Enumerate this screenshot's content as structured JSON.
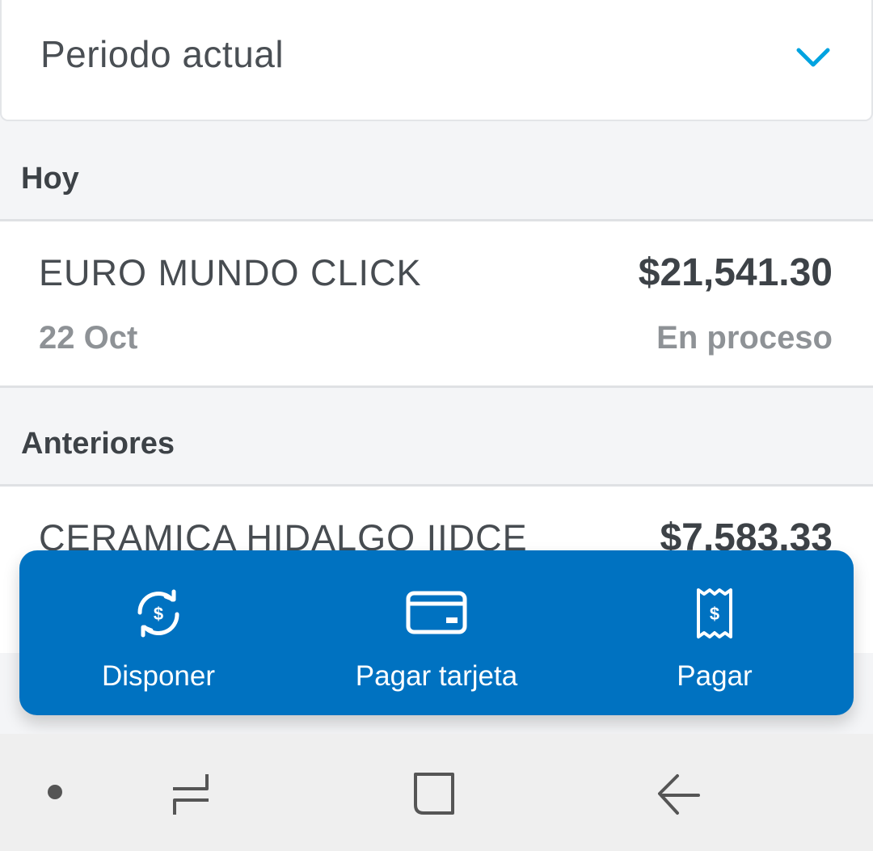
{
  "period": {
    "label": "Periodo actual"
  },
  "sections": [
    {
      "title": "Hoy",
      "transactions": [
        {
          "merchant": "EURO MUNDO CLICK",
          "amount": "$21,541.30",
          "date": "22 Oct",
          "status": "En proceso"
        }
      ]
    },
    {
      "title": "Anteriores",
      "transactions": [
        {
          "merchant": "CERAMICA HIDALGO IIDCE",
          "amount": "$7,583.33"
        }
      ]
    }
  ],
  "actions": [
    {
      "label": "Disponer",
      "icon": "cash-exchange-icon"
    },
    {
      "label": "Pagar tarjeta",
      "icon": "credit-card-icon"
    },
    {
      "label": "Pagar",
      "icon": "receipt-icon"
    }
  ],
  "colors": {
    "accent": "#00a3e0",
    "action_bar": "#0072c1",
    "background": "#f4f5f7"
  }
}
